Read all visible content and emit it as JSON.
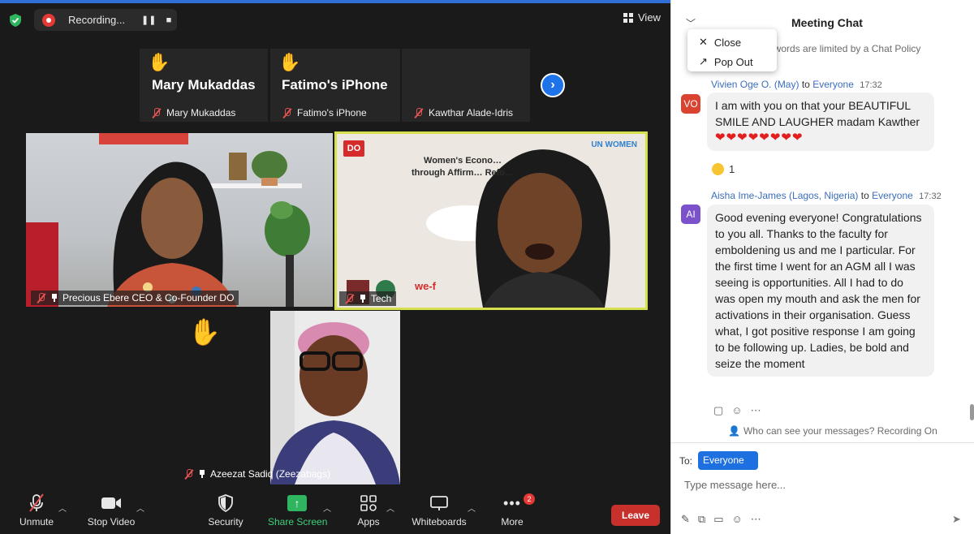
{
  "top_bar": {
    "recording_label": "Recording...",
    "pause_glyph": "❚❚",
    "stop_glyph": "■",
    "view_label": "View"
  },
  "strip": {
    "tiles": [
      {
        "name_large": "Mary Mukaddas",
        "label": "Mary Mukaddas",
        "hand": "✋"
      },
      {
        "name_large": "Fatimo's iPhone",
        "label": "Fatimo's iPhone",
        "hand": "✋"
      },
      {
        "name_large": "",
        "label": "Kawthar Alade-Idris",
        "hand": ""
      }
    ],
    "next_glyph": "›"
  },
  "videos": {
    "tile1_label": "Precious Ebere CEO & Co-Founder DO",
    "tile2_label": "Tech",
    "tile2_slide_title": "Women's Econo… through Affirm… Refo…",
    "tile2_logo_left": "DO",
    "tile2_logo_right": "UN WOMEN",
    "tile2_footer": "we-f",
    "tile3_label": "Azeezat Sadiq (Zeezabags)",
    "tile3_hand": "✋"
  },
  "toolbar": {
    "unmute": "Unmute",
    "stop_video": "Stop Video",
    "security": "Security",
    "share_screen": "Share Screen",
    "apps": "Apps",
    "whiteboards": "Whiteboards",
    "more": "More",
    "more_badge": "2",
    "leave": "Leave"
  },
  "chat": {
    "title": "Meeting Chat",
    "menu": {
      "close": "Close",
      "pop_out": "Pop Out"
    },
    "policy_notice": "ed words are limited by a Chat Policy",
    "messages": [
      {
        "sender": "Vivien Oge O. (May)",
        "to": "to",
        "recipient": "Everyone",
        "time": "17:32",
        "initials": "VO",
        "avatar_color": "#d9432f",
        "text": "I am with you on that your BEAUTIFUL SMILE AND LAUGHER madam Kawther",
        "hearts": "❤❤❤❤❤❤❤❤",
        "reaction_count": "1"
      },
      {
        "sender": "Aisha Ime-James (Lagos, Nigeria)",
        "to": "to",
        "recipient": "Everyone",
        "time": "17:32",
        "initials": "AI",
        "avatar_color": "#7b52c9",
        "text": "Good evening everyone! Congratulations to you all. Thanks to the faculty for emboldening us and me I particular. For the first time I went for an AGM all I was seeing is opportunities. All I had to do was open my mouth and ask the men for activations in their organisation. Guess what, I got positive response I am going to be following up. Ladies, be bold and seize the moment"
      }
    ],
    "visibility_notice": "Who can see your messages? Recording On",
    "to_label": "To:",
    "to_value": "Everyone",
    "input_placeholder": "Type message here..."
  },
  "colors": {
    "accent": "#1e6fe0",
    "share_green": "#2fb45f",
    "leave_red": "#c8302c",
    "sender_blue": "#3a6ebd"
  }
}
